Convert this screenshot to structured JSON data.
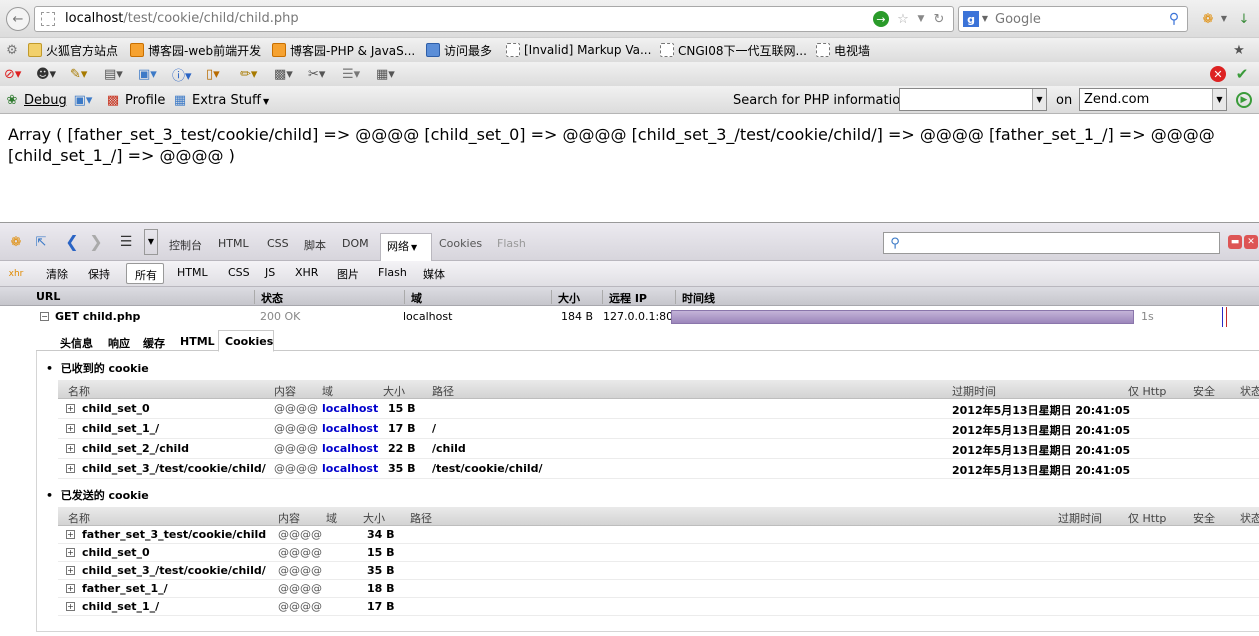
{
  "browser": {
    "url_host": "localhost",
    "url_path": "/test/cookie/child/child.php",
    "search_engine": "Google"
  },
  "bookmarks": [
    {
      "label": "火狐官方站点",
      "icon": "folder-icon"
    },
    {
      "label": "博客园-web前端开发",
      "icon": "rss-icon"
    },
    {
      "label": "博客园-PHP & JavaS...",
      "icon": "rss-icon"
    },
    {
      "label": "访问最多",
      "icon": "search-icon"
    },
    {
      "label": "[Invalid] Markup Va...",
      "icon": "page-icon"
    },
    {
      "label": "CNGI08下一代互联网...",
      "icon": "page-icon"
    },
    {
      "label": "电视墙",
      "icon": "page-icon"
    }
  ],
  "zend_bar": {
    "debug_label": "Debug",
    "profile_label": "Profile",
    "extra_label": "Extra Stuff",
    "search_label": "Search for PHP information:",
    "on_label": "on",
    "site_value": "Zend.com"
  },
  "page_output": "Array ( [father_set_3_test/cookie/child] => @@@@ [child_set_0] => @@@@ [child_set_3_/test/cookie/child/] => @@@@ [father_set_1_/] => @@@@ [child_set_1_/] => @@@@ )",
  "firebug": {
    "panels": [
      "控制台",
      "HTML",
      "CSS",
      "脚本",
      "DOM",
      "网络",
      "Cookies",
      "Flash"
    ],
    "filters": [
      "清除",
      "保持",
      "所有",
      "HTML",
      "CSS",
      "JS",
      "XHR",
      "图片",
      "Flash",
      "媒体"
    ],
    "net_columns": [
      "URL",
      "状态",
      "域",
      "大小",
      "远程 IP",
      "时间线"
    ],
    "request": {
      "method_url": "GET child.php",
      "status": "200 OK",
      "domain": "localhost",
      "size": "184 B",
      "remote_ip": "127.0.0.1:80",
      "duration": "1s"
    },
    "detail_tabs": [
      "头信息",
      "响应",
      "缓存",
      "HTML",
      "Cookies"
    ],
    "received_title": "已收到的 cookie",
    "sent_title": "已发送的 cookie",
    "cookie_columns": [
      "名称",
      "内容",
      "域",
      "大小",
      "路径",
      "过期时间",
      "仅 Http",
      "安全",
      "状态"
    ],
    "received": [
      {
        "name": "child_set_0",
        "value": "@@@@",
        "domain": "localhost",
        "size": "15 B",
        "path": "",
        "expires": "2012年5月13日星期日 20:41:05"
      },
      {
        "name": "child_set_1_/",
        "value": "@@@@",
        "domain": "localhost",
        "size": "17 B",
        "path": "/",
        "expires": "2012年5月13日星期日 20:41:05"
      },
      {
        "name": "child_set_2_/child",
        "value": "@@@@",
        "domain": "localhost",
        "size": "22 B",
        "path": "/child",
        "expires": "2012年5月13日星期日 20:41:05"
      },
      {
        "name": "child_set_3_/test/cookie/child/",
        "value": "@@@@",
        "domain": "localhost",
        "size": "35 B",
        "path": "/test/cookie/child/",
        "expires": "2012年5月13日星期日 20:41:05"
      }
    ],
    "sent": [
      {
        "name": "father_set_3_test/cookie/child",
        "value": "@@@@",
        "size": "34 B"
      },
      {
        "name": "child_set_0",
        "value": "@@@@",
        "size": "15 B"
      },
      {
        "name": "child_set_3_/test/cookie/child/",
        "value": "@@@@",
        "size": "35 B"
      },
      {
        "name": "father_set_1_/",
        "value": "@@@@",
        "size": "18 B"
      },
      {
        "name": "child_set_1_/",
        "value": "@@@@",
        "size": "17 B"
      }
    ]
  }
}
